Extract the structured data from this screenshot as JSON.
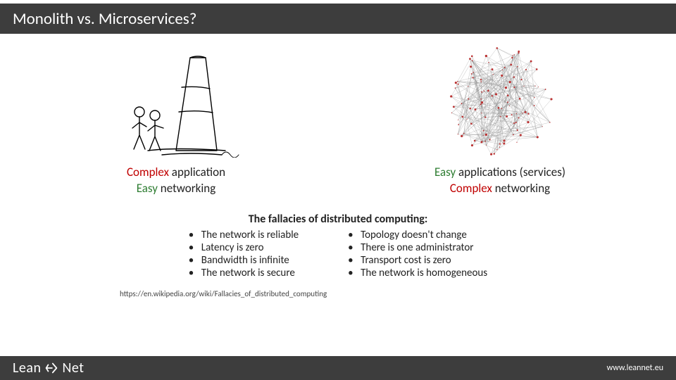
{
  "title": "Monolith vs. Microservices?",
  "left": {
    "line1_red": "Complex",
    "line1_rest": " application",
    "line2_green": "Easy",
    "line2_rest": " networking"
  },
  "right": {
    "line1_green": "Easy",
    "line1_rest": " applications (services)",
    "line2_red": "Complex",
    "line2_rest": " networking"
  },
  "fallacies_title": "The fallacies of distributed computing:",
  "fallacies_left": [
    "The network is reliable",
    "Latency is zero",
    "Bandwidth is infinite",
    "The network is secure"
  ],
  "fallacies_right": [
    "Topology doesn't change",
    "There is one administrator",
    "Transport cost is zero",
    "The network is homogeneous"
  ],
  "citation": "https://en.wikipedia.org/wiki/Fallacies_of_distributed_computing",
  "logo_word1": "Lean",
  "logo_word2": "Net",
  "footer_url": "www.leannet.eu"
}
